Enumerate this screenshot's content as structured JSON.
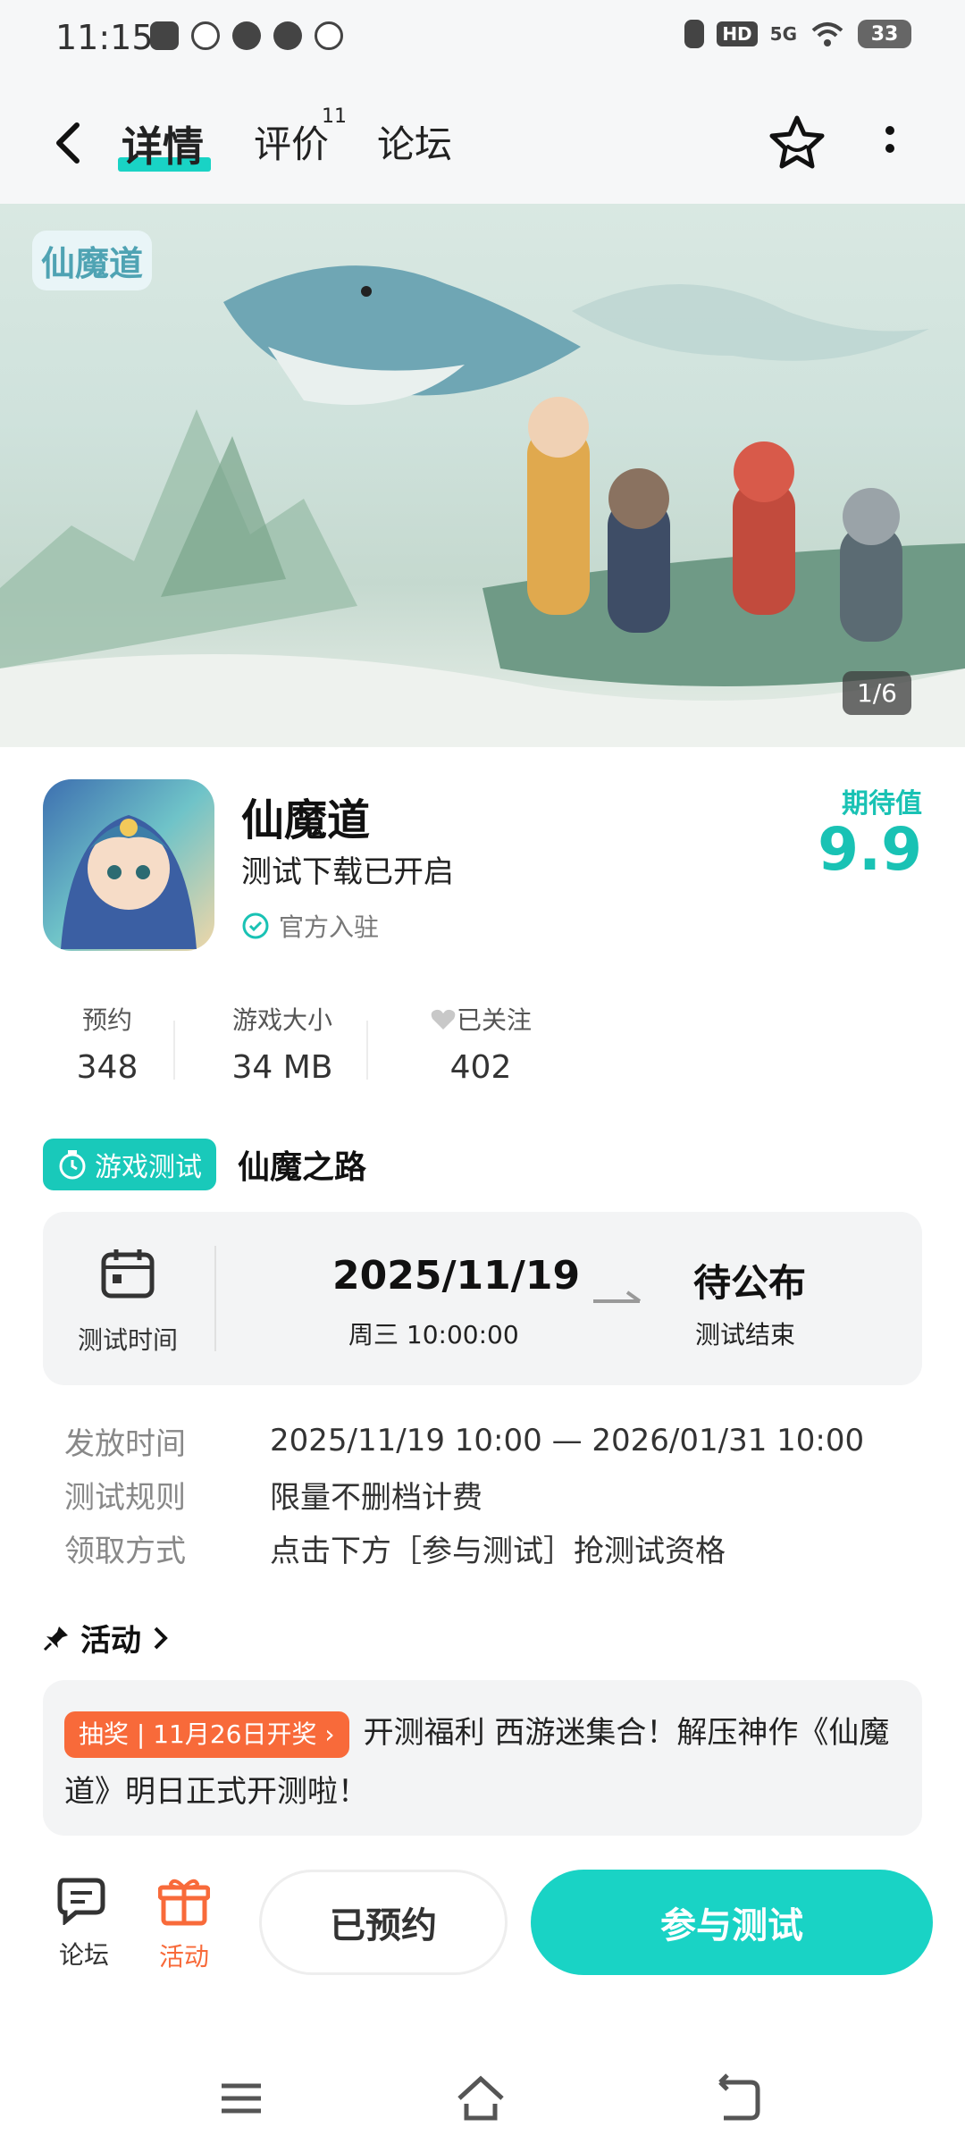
{
  "status_bar": {
    "time": "11:15",
    "network": "5G",
    "hd": "HD",
    "battery": "33"
  },
  "header": {
    "tabs": [
      {
        "label": "详情"
      },
      {
        "label": "评价",
        "badge": "11"
      },
      {
        "label": "论坛"
      }
    ]
  },
  "banner": {
    "logo_text": "仙魔道",
    "counter": "1/6"
  },
  "app": {
    "name": "仙魔道",
    "subtitle": "测试下载已开启",
    "official": "官方入驻",
    "expect_label": "期待值",
    "expect_value": "9.9"
  },
  "stats": [
    {
      "label": "预约",
      "value": "348"
    },
    {
      "label": "游戏大小",
      "value": "34 MB"
    },
    {
      "label": "已关注",
      "value": "402"
    }
  ],
  "test": {
    "badge": "游戏测试",
    "name": "仙魔之路",
    "time_label": "测试时间",
    "start_date": "2025/11/19",
    "start_weekday_time": "周三  10:00:00",
    "end_status": "待公布",
    "end_label": "测试结束"
  },
  "details": [
    {
      "label": "发放时间",
      "value": "2025/11/19 10:00 — 2026/01/31 10:00"
    },
    {
      "label": "测试规则",
      "value": "限量不删档计费"
    },
    {
      "label": "领取方式",
      "value": "点击下方［参与测试］抢测试资格"
    }
  ],
  "activity": {
    "title": "活动",
    "badge": "抽奖 | 11月26日开奖",
    "text": "开测福利 西游迷集合！解压神作《仙魔道》明日正式开测啦！"
  },
  "bottom": {
    "forum_label": "论坛",
    "activity_label": "活动",
    "reserved_label": "已预约",
    "join_label": "参与测试"
  },
  "colors": {
    "accent": "#19d3c5",
    "orange": "#f86a3a"
  }
}
